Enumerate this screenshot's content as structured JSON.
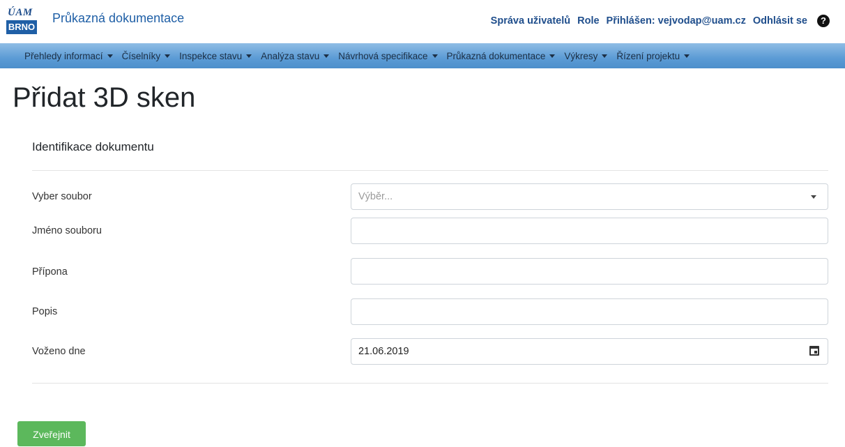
{
  "logo": {
    "top_text": "ÚAM",
    "bottom_text": "BRNO"
  },
  "header": {
    "app_title": "Průkazná dokumentace",
    "links": {
      "user_admin": "Správa uživatelů",
      "role": "Role",
      "logged_in": "Přihlášen: vejvodap@uam.cz",
      "logout": "Odhlásit se"
    },
    "help_icon": "question-circle-icon"
  },
  "nav": {
    "items": [
      "Přehledy informací",
      "Číselníky",
      "Inspekce stavu",
      "Analýza stavu",
      "Návrhová specifikace",
      "Průkazná dokumentace",
      "Výkresy",
      "Řízení projektu"
    ]
  },
  "page": {
    "title": "Přidat 3D sken",
    "section_title": "Identifikace dokumentu"
  },
  "form": {
    "file_select": {
      "label": "Vyber soubor",
      "placeholder": "Výběr..."
    },
    "file_name": {
      "label": "Jméno souboru",
      "value": ""
    },
    "extension": {
      "label": "Přípona",
      "value": ""
    },
    "description": {
      "label": "Popis",
      "value": ""
    },
    "uploaded_on": {
      "label": "Voženo dne",
      "value": "21.06.2019"
    }
  },
  "actions": {
    "publish": "Zveřejnit"
  },
  "colors": {
    "brand_blue": "#1f5fa6",
    "nav_blue": "#5b9bd5",
    "publish_green": "#5cb85c"
  }
}
